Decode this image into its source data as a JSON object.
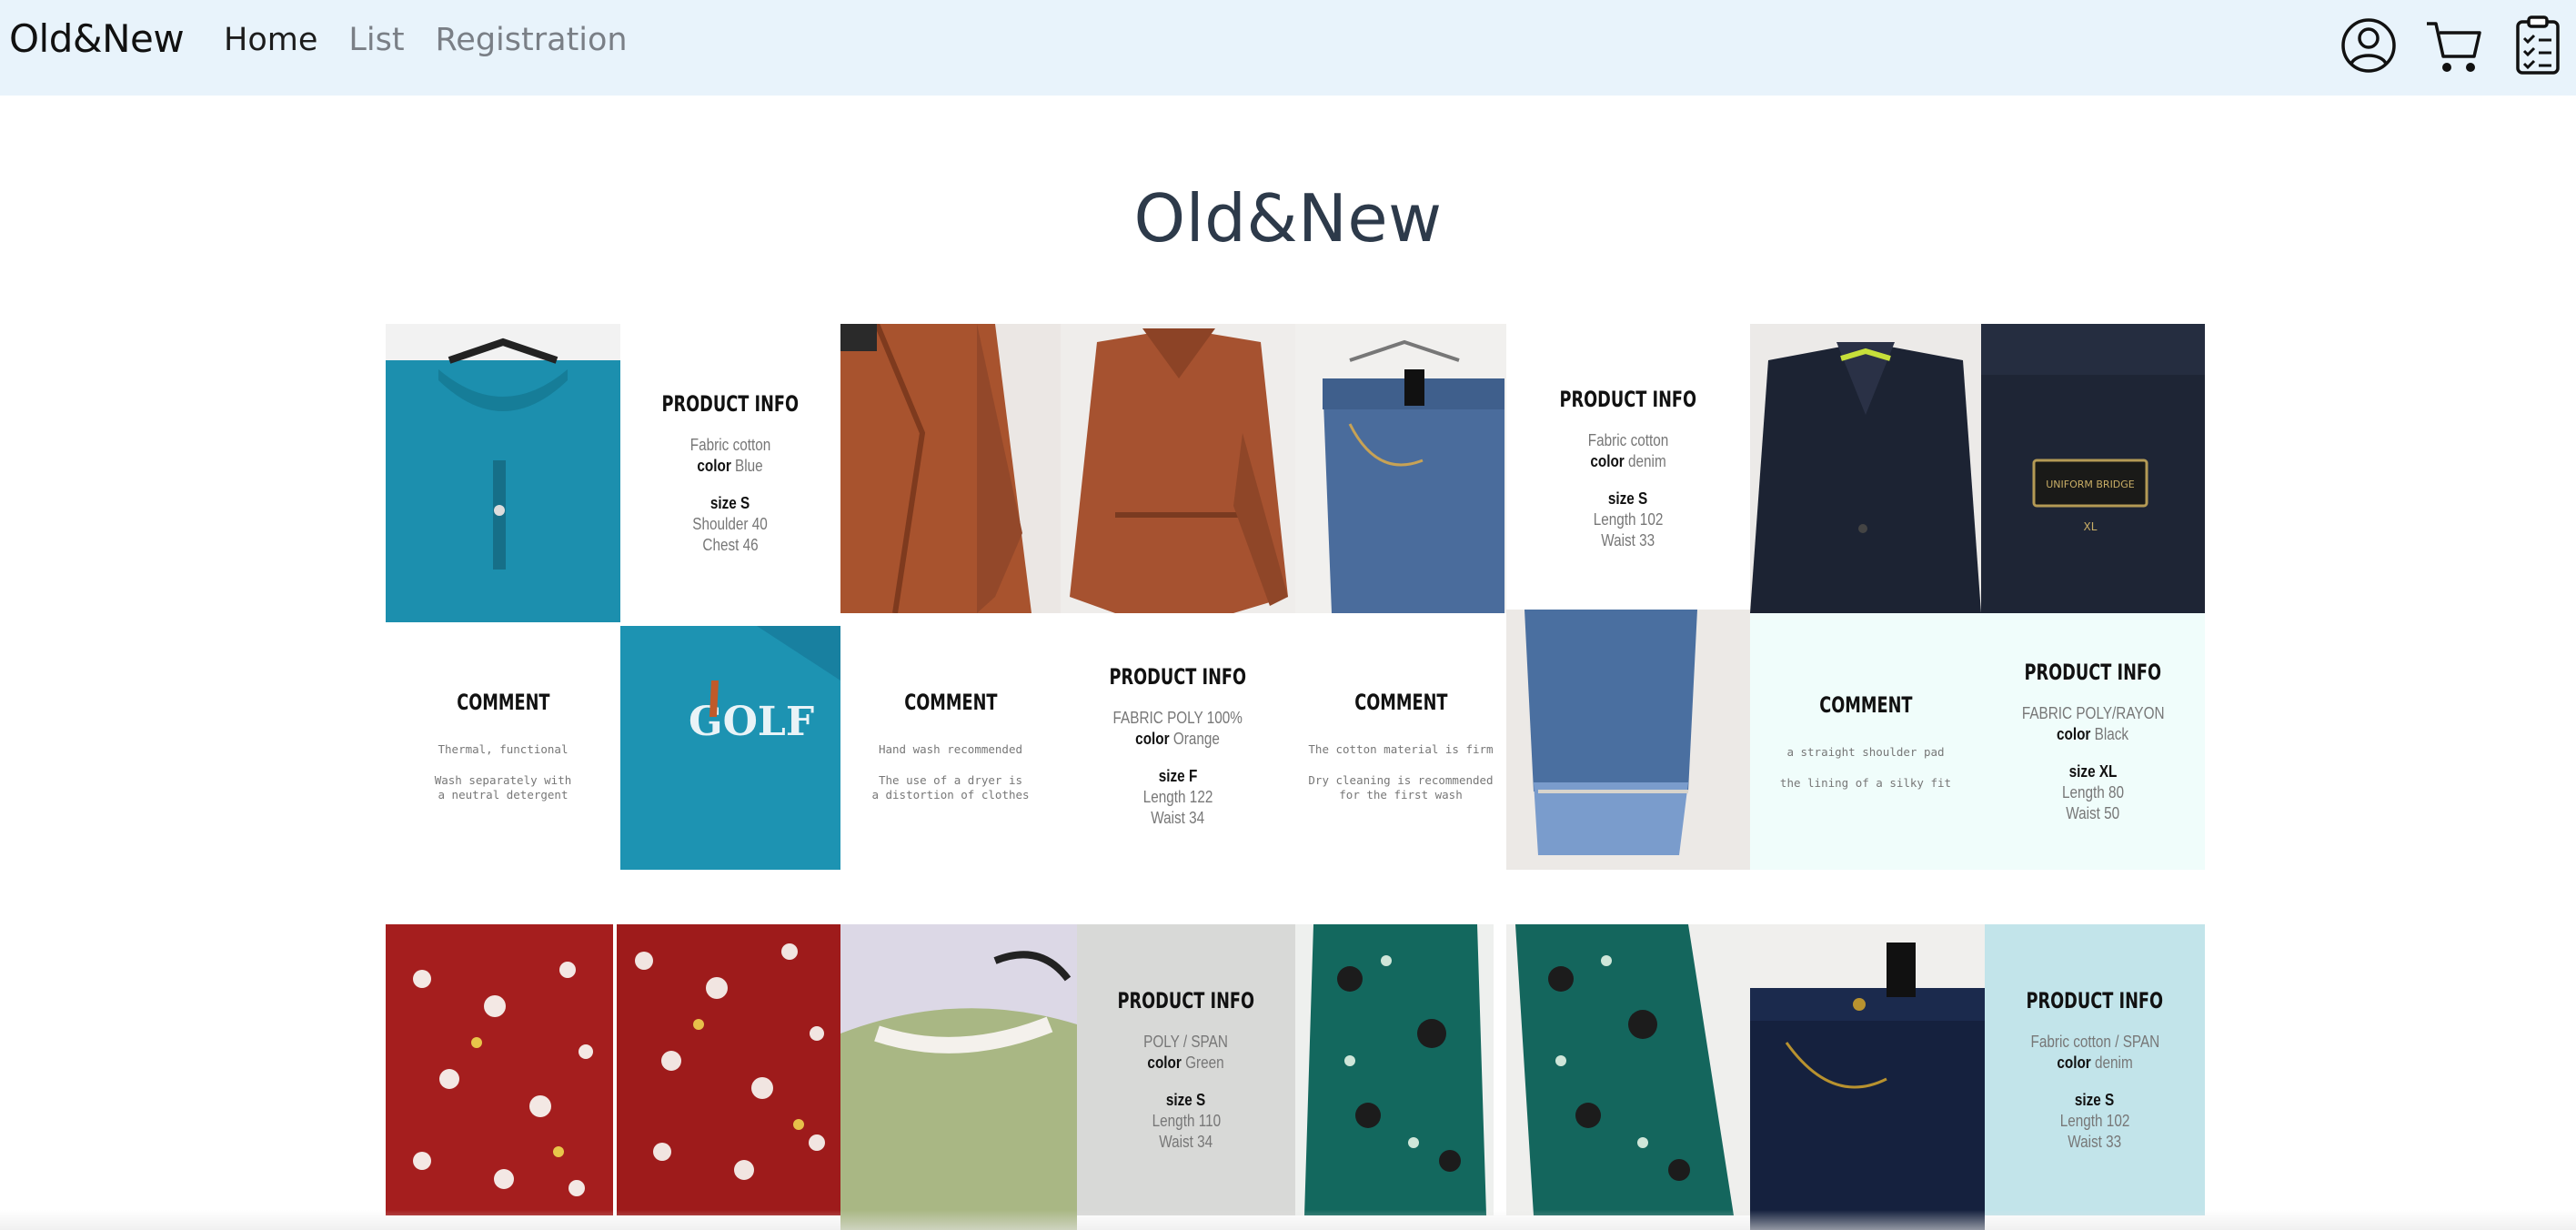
{
  "navbar": {
    "brand": "Old&New",
    "links": [
      {
        "label": "Home",
        "active": true
      },
      {
        "label": "List",
        "active": false
      },
      {
        "label": "Registration",
        "active": false
      }
    ],
    "icons": [
      "user-icon",
      "cart-icon",
      "clipboard-icon"
    ]
  },
  "page": {
    "title": "Old&New"
  },
  "info_cards": {
    "blue_polo": {
      "title": "PRODUCT INFO",
      "fabric_line": "Fabric cotton",
      "color_label": "color",
      "color_value": "Blue",
      "size_label": "size",
      "size_value": "S",
      "m1": "Shoulder 40",
      "m2": "Chest 46"
    },
    "denim_jeans": {
      "title": "PRODUCT INFO",
      "fabric_line": "Fabric cotton",
      "color_label": "color",
      "color_value": "denim",
      "size_label": "size",
      "size_value": "S",
      "m1": "Length 102",
      "m2": "Waist 33"
    },
    "orange_dress": {
      "title": "PRODUCT INFO",
      "fabric_line": "FABRIC POLY 100%",
      "color_label": "color",
      "color_value": "Orange",
      "size_label": "size",
      "size_value": "F",
      "m1": "Length 122",
      "m2": "Waist 34"
    },
    "black_blazer": {
      "title": "PRODUCT INFO",
      "fabric_line": "FABRIC POLY/RAYON",
      "color_label": "color",
      "color_value": "Black",
      "size_label": "size",
      "size_value": "XL",
      "m1": "Length 80",
      "m2": "Waist 50"
    },
    "green_tweed": {
      "title": "PRODUCT INFO",
      "fabric_line": "POLY / SPAN",
      "color_label": "color",
      "color_value": "Green",
      "size_label": "size",
      "size_value": "S",
      "m1": "Length 110",
      "m2": "Waist 34"
    },
    "denim_pants_2": {
      "title": "PRODUCT INFO",
      "fabric_line": "Fabric cotton / SPAN",
      "color_label": "color",
      "color_value": "denim",
      "size_label": "size",
      "size_value": "S",
      "m1": "Length 102",
      "m2": "Waist 33"
    }
  },
  "comment_cards": {
    "blue_polo": {
      "title": "COMMENT",
      "l1": "Thermal, functional",
      "l2": "Wash separately with",
      "l3": "a neutral detergent"
    },
    "orange_dress": {
      "title": "COMMENT",
      "l1": "Hand wash recommended",
      "l2": "The use of a dryer is",
      "l3": "a distortion of clothes"
    },
    "denim_jeans": {
      "title": "COMMENT",
      "l1": "The cotton material is firm",
      "l2": "Dry cleaning is recommended",
      "l3": "for the first wash"
    },
    "black_blazer": {
      "title": "COMMENT",
      "l1": "a straight shoulder pad",
      "l2": "the lining of a silky fit"
    }
  },
  "photo_graphics": {
    "golf_text": "GOLF",
    "uniform_label_1": "UNIFORM BRIDGE",
    "uniform_label_2": "XL"
  },
  "colors": {
    "navbar_bg": "#e8f3fb",
    "mint_tile": "#f0fdfb",
    "grey_tile": "#d8d9d7",
    "teal_tile": "#c2e4ea"
  }
}
